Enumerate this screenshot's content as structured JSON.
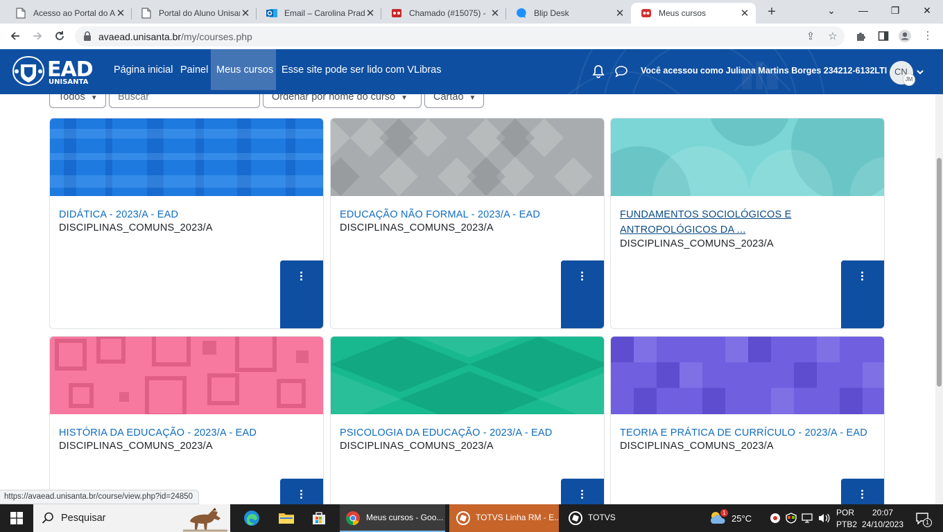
{
  "browser": {
    "tabs": [
      {
        "title": "Acesso ao Portal do Aluno",
        "icon": "document-icon"
      },
      {
        "title": "Portal do Aluno Unisanta",
        "icon": "document-icon"
      },
      {
        "title": "Email – Carolina Prado",
        "icon": "outlook-icon"
      },
      {
        "title": "Chamado (#15075) - ",
        "icon": "ticket-icon"
      },
      {
        "title": "Blip Desk",
        "icon": "chat-bubble-icon"
      },
      {
        "title": "Meus cursos",
        "icon": "unisanta-icon"
      }
    ],
    "new_tab": "+",
    "url_domain": "avaead.unisanta.br",
    "url_path": "/my/courses.php"
  },
  "navbar": {
    "brand_main": "EAD",
    "brand_sub": "UNISANTA",
    "links": [
      "Página inicial",
      "Painel",
      "Meus cursos",
      "Esse site pode ser lido com VLibras"
    ],
    "active_link": "Meus cursos",
    "logged_in_text": "Você acessou como Juliana Martins Borges 234212-6132LTI",
    "avatar_initials": "CN",
    "avatar_sub_initials": "JM"
  },
  "filters": {
    "status": "Todos",
    "search_placeholder": "Buscar",
    "sort": "Ordenar por nome do curso",
    "view": "Cartão"
  },
  "courses": [
    {
      "title": "DIDÁTICA - 2023/A - EAD",
      "category": "DISCIPLINAS_COMUNS_2023/A",
      "image_color": "#1f7ae0"
    },
    {
      "title": "EDUCAÇÃO NÃO FORMAL - 2023/A - EAD",
      "category": "DISCIPLINAS_COMUNS_2023/A",
      "image_color": "#a9acae"
    },
    {
      "title": "FUNDAMENTOS SOCIOLÓGICOS E ANTROPOLÓGICOS DA ...",
      "category": "DISCIPLINAS_COMUNS_2023/A",
      "image_color": "#7cd6d6"
    },
    {
      "title": "HISTÓRIA DA EDUCAÇÃO - 2023/A - EAD",
      "category": "DISCIPLINAS_COMUNS_2023/A",
      "image_color": "#f7799f"
    },
    {
      "title": "PSICOLOGIA DA EDUCAÇÃO - 2023/A - EAD",
      "category": "DISCIPLINAS_COMUNS_2023/A",
      "image_color": "#18b98f"
    },
    {
      "title": "TEORIA E PRÁTICA DE CURRÍCULO - 2023/A - EAD",
      "category": "DISCIPLINAS_COMUNS_2023/A",
      "image_color": "#7060e0"
    }
  ],
  "status_url": "https://avaead.unisanta.br/course/view.php?id=24850",
  "taskbar": {
    "search_label": "Pesquisar",
    "tasks": [
      "Meus cursos - Goo...",
      "TOTVS Linha RM - E...",
      "TOTVS"
    ],
    "weather": "25°C",
    "weather_badge": "1",
    "lang": "POR",
    "lang_sub": "PTB2",
    "time": "20:07",
    "date": "24/10/2023",
    "notifications": "1"
  }
}
